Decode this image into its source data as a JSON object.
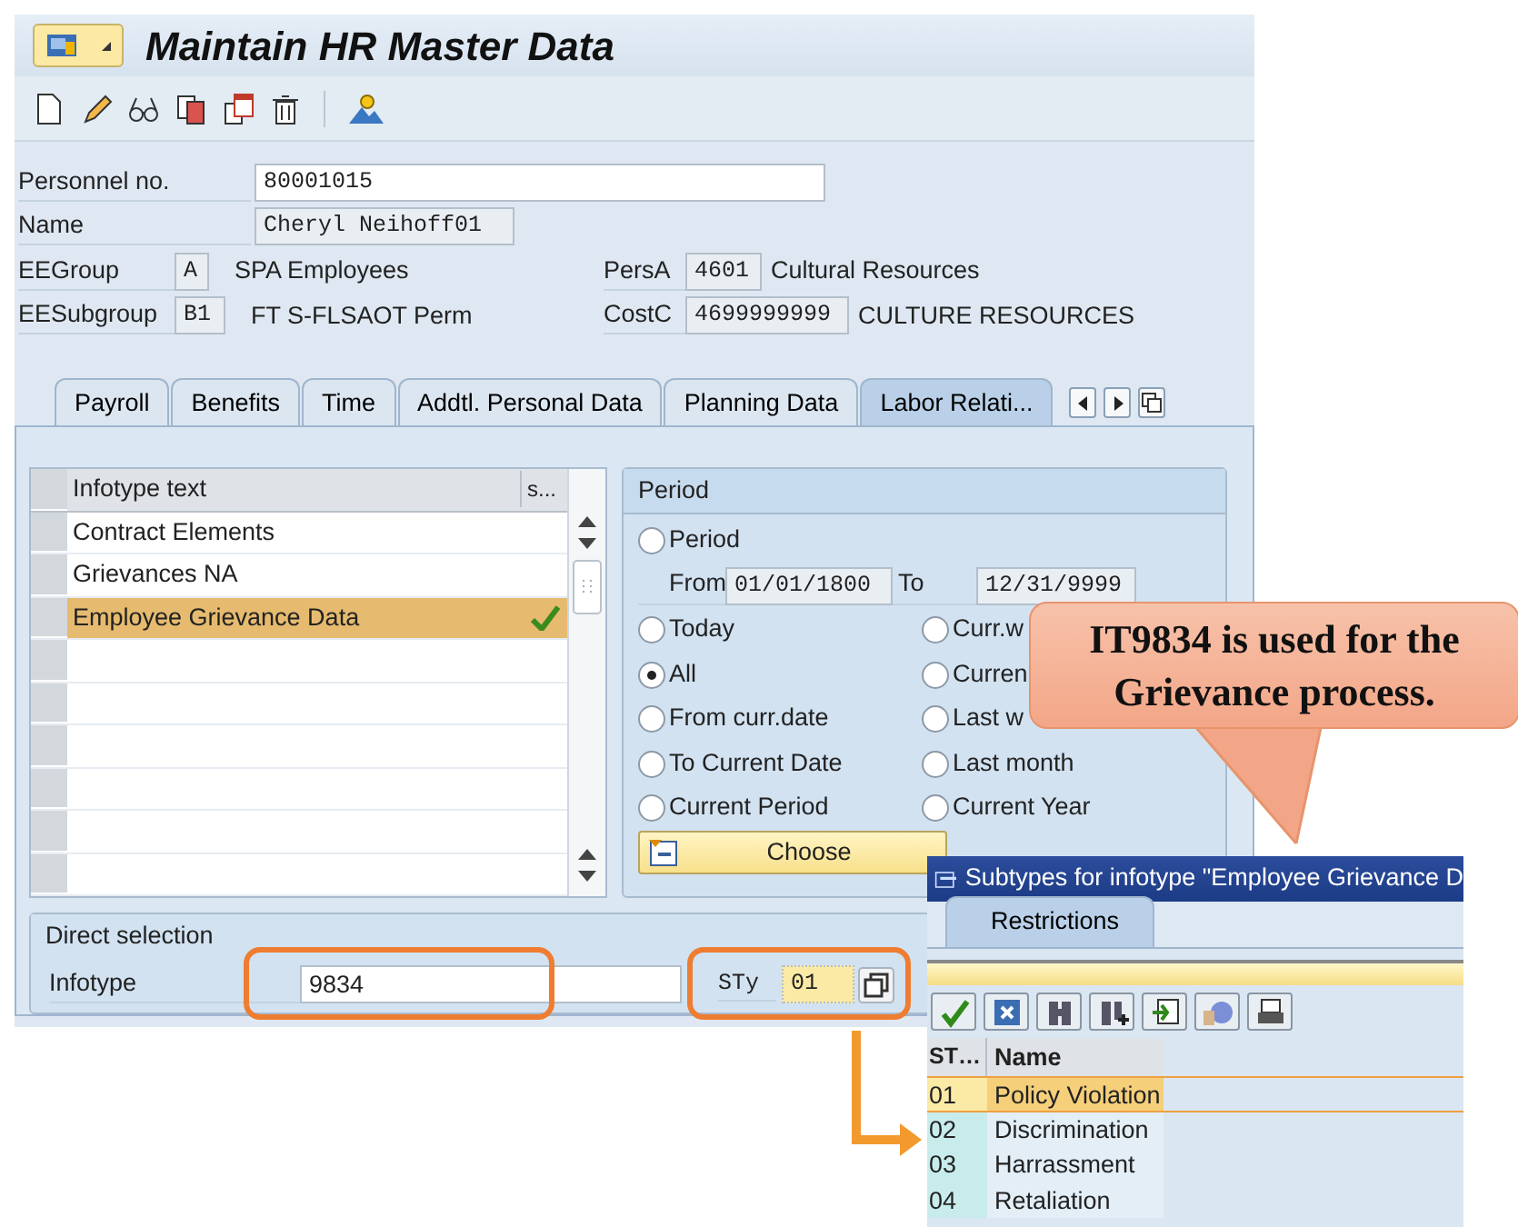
{
  "window": {
    "title": "Maintain HR Master Data"
  },
  "personnel_no": {
    "label": "Personnel no.",
    "value": "80001015"
  },
  "name": {
    "label": "Name",
    "value": "Cheryl Neihoff01"
  },
  "org_left": [
    {
      "label": "EEGroup",
      "code": "A",
      "text": "SPA Employees"
    },
    {
      "label": "EESubgroup",
      "code": "B1",
      "text": "FT S-FLSAOT Perm"
    }
  ],
  "org_right": [
    {
      "label": "PersA",
      "code": "4601",
      "text": "Cultural Resources"
    },
    {
      "label": "CostC",
      "code": "4699999999",
      "text": "CULTURE RESOURCES"
    }
  ],
  "tabs": [
    {
      "label": "Payroll",
      "selected": false
    },
    {
      "label": "Benefits",
      "selected": false
    },
    {
      "label": "Time",
      "selected": false
    },
    {
      "label": "Addtl. Personal Data",
      "selected": false
    },
    {
      "label": "Planning Data",
      "selected": false
    },
    {
      "label": "Labor Relati...",
      "selected": true
    }
  ],
  "infotype_table": {
    "columns": [
      "Infotype text",
      "s..."
    ],
    "rows": [
      {
        "text": "Contract Elements",
        "selected": false,
        "checked": false
      },
      {
        "text": "Grievances NA",
        "selected": false,
        "checked": false
      },
      {
        "text": "Employee Grievance Data",
        "selected": true,
        "checked": true
      }
    ]
  },
  "period": {
    "title": "Period",
    "period_option": {
      "label": "Period",
      "selected": false
    },
    "from_label": "From",
    "from": "01/01/1800",
    "to_label": "To",
    "to": "12/31/9999",
    "left_options": [
      {
        "label": "Today",
        "selected": false
      },
      {
        "label": "All",
        "selected": true
      },
      {
        "label": "From curr.date",
        "selected": false
      },
      {
        "label": "To Current Date",
        "selected": false
      },
      {
        "label": "Current Period",
        "selected": false
      }
    ],
    "right_options": [
      {
        "label": "Curr.w",
        "selected": false
      },
      {
        "label": "Curren",
        "selected": false
      },
      {
        "label": "Last w",
        "selected": false
      },
      {
        "label": "Last month",
        "selected": false
      },
      {
        "label": "Current Year",
        "selected": false
      }
    ],
    "choose": "Choose"
  },
  "direct_selection": {
    "title": "Direct selection",
    "label": "Infotype",
    "value": "9834",
    "subtype_label": "STy",
    "subtype_value": "01"
  },
  "popup": {
    "title": "Subtypes for infotype \"Employee Grievance D",
    "tabs": [
      {
        "label": "Restrictions",
        "selected": true
      }
    ],
    "columns": [
      "ST…",
      "Name"
    ],
    "rows": [
      {
        "code": "01",
        "name": "Policy Violation",
        "selected": true
      },
      {
        "code": "02",
        "name": "Discrimination",
        "selected": false
      },
      {
        "code": "03",
        "name": "Harrassment",
        "selected": false
      },
      {
        "code": "04",
        "name": "Retaliation",
        "selected": false
      }
    ]
  },
  "callout": {
    "text": "IT9834 is used for the Grievance process."
  }
}
